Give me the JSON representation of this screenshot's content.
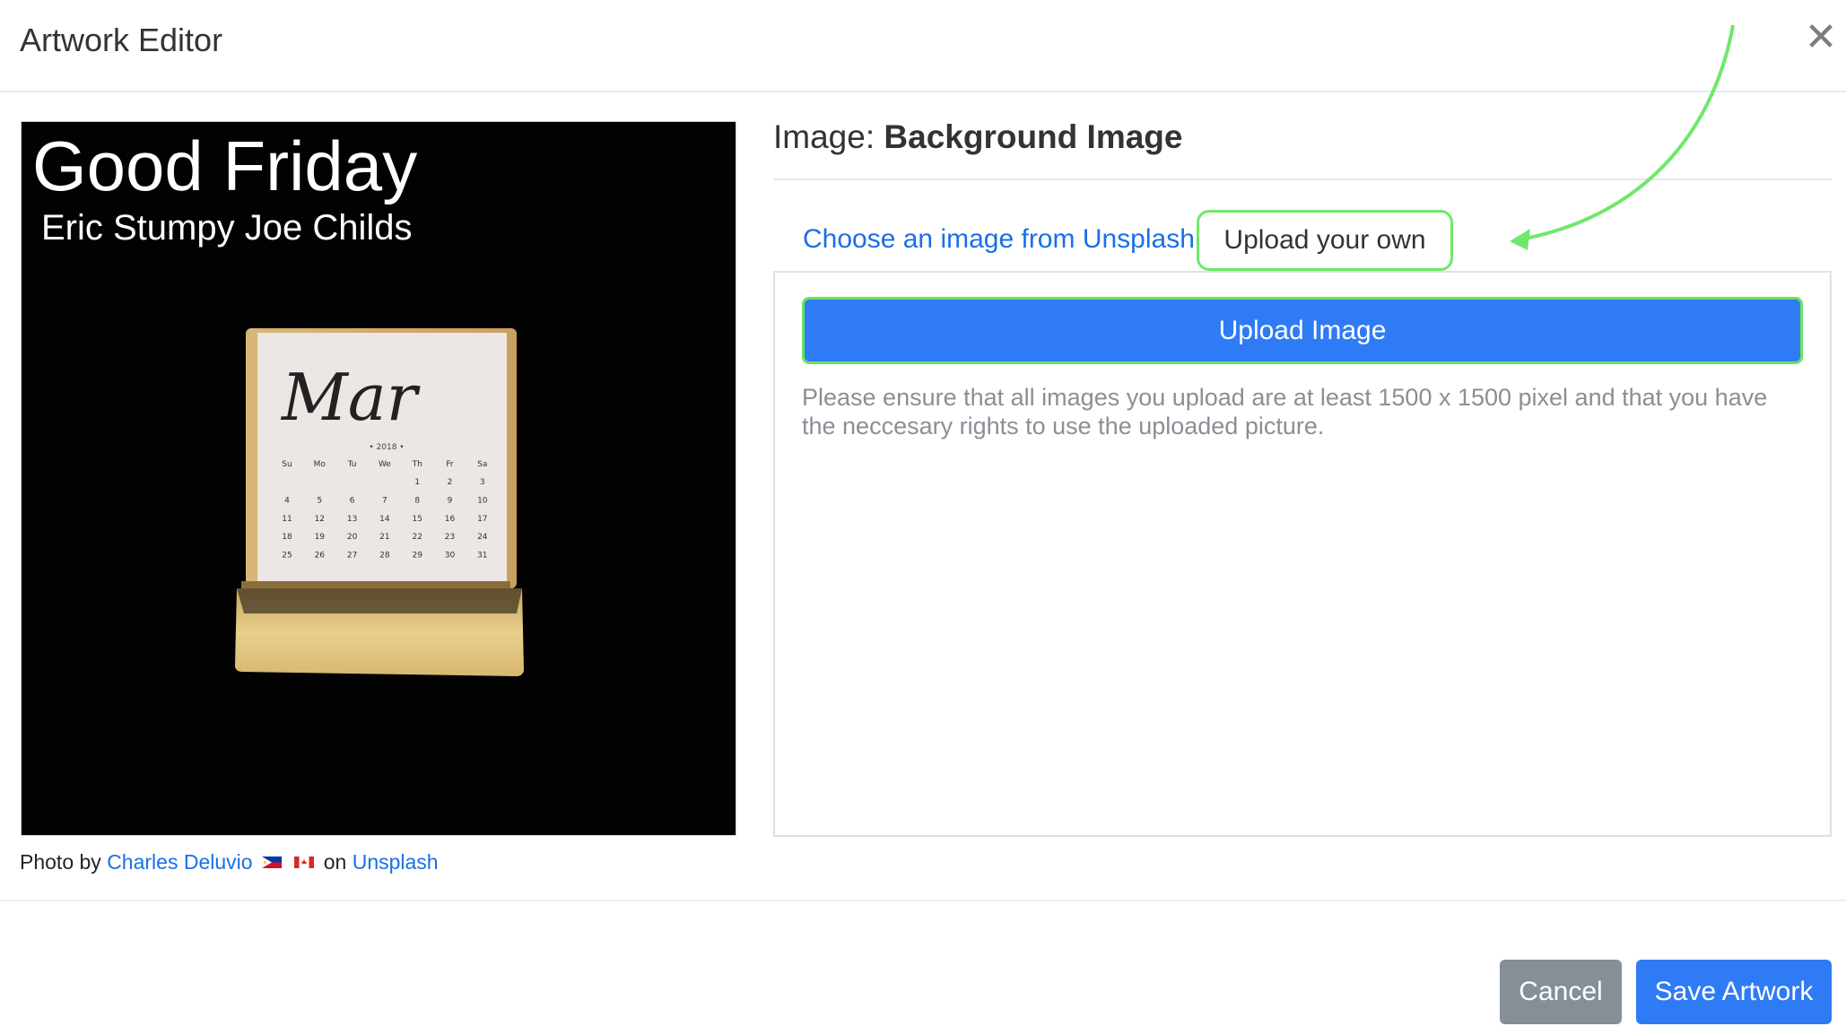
{
  "header": {
    "title": "Artwork Editor",
    "close_icon": "close-icon"
  },
  "preview": {
    "title": "Good Friday",
    "subtitle": "Eric Stumpy Joe Childs",
    "calendar": {
      "month_script": "Mar",
      "year": "• 2018 •",
      "weekdays": [
        "Su",
        "Mo",
        "Tu",
        "We",
        "Th",
        "Fr",
        "Sa"
      ],
      "weeks": [
        [
          "",
          "",
          "",
          "",
          "1",
          "2",
          "3"
        ],
        [
          "4",
          "5",
          "6",
          "7",
          "8",
          "9",
          "10"
        ],
        [
          "11",
          "12",
          "13",
          "14",
          "15",
          "16",
          "17"
        ],
        [
          "18",
          "19",
          "20",
          "21",
          "22",
          "23",
          "24"
        ],
        [
          "25",
          "26",
          "27",
          "28",
          "29",
          "30",
          "31"
        ]
      ]
    }
  },
  "credit": {
    "prefix": "Photo by",
    "author": "Charles Deluvio",
    "middle": "on",
    "source": "Unsplash",
    "flags": [
      "philippines-flag-icon",
      "canada-flag-icon"
    ]
  },
  "panel": {
    "label": "Image:",
    "name": "Background Image",
    "tabs": [
      {
        "label": "Choose an image from Unsplash",
        "active": false
      },
      {
        "label": "Upload your own",
        "active": true
      }
    ],
    "upload_button": "Upload Image",
    "hint": "Please ensure that all images you upload are at least 1500 x 1500 pixel and that you have the neccesary rights to use the uploaded picture."
  },
  "footer": {
    "cancel": "Cancel",
    "save": "Save Artwork"
  },
  "colors": {
    "accent": "#2f7bf5",
    "highlight": "#70e86b",
    "cancel": "#868e96",
    "link": "#1a6fe8"
  }
}
